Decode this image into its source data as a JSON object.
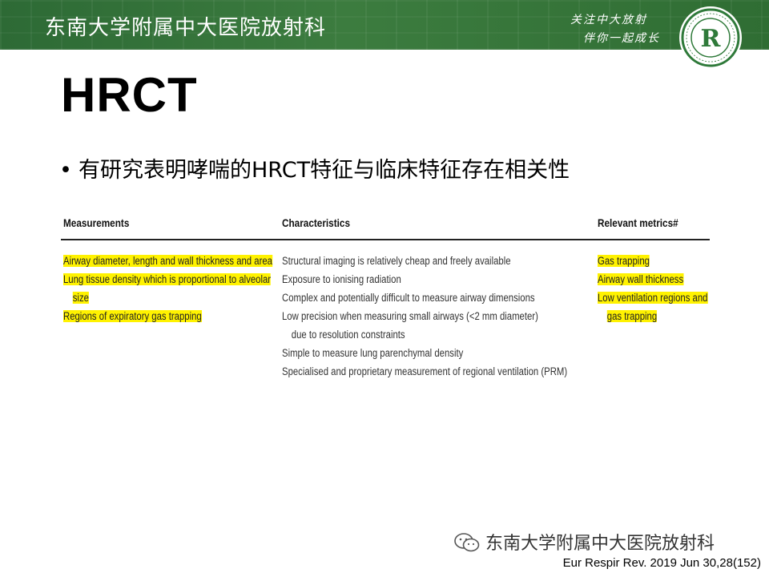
{
  "banner": {
    "title": "东南大学附属中大医院放射科",
    "slogan_line1": "关注中大放射",
    "slogan_line2": "伴你一起成长",
    "logo_letter": "R"
  },
  "slide": {
    "heading": "HRCT",
    "bullet": "有研究表明哮喘的HRCT特征与临床特征存在相关性"
  },
  "table": {
    "headers": {
      "measurements": "Measurements",
      "characteristics": "Characteristics",
      "relevant_metrics": "Relevant metrics#"
    },
    "measurements": [
      "Airway diameter, length and wall thickness and area",
      "Lung tissue density which is proportional to alveolar",
      "size",
      "Regions of expiratory gas trapping"
    ],
    "characteristics": [
      "Structural imaging is relatively cheap and freely available",
      "Exposure to ionising radiation",
      "Complex and potentially difficult to measure airway dimensions",
      "Low precision when measuring small airways (<2 mm diameter)",
      "due to resolution constraints",
      "Simple to measure lung parenchymal density",
      "Specialised and proprietary measurement of regional ventilation (PRM)"
    ],
    "relevant_metrics": [
      "Gas trapping",
      "Airway wall thickness",
      "Low ventilation regions and",
      "gas trapping"
    ]
  },
  "footer": {
    "brand": "东南大学附属中大医院放射科",
    "citation": "Eur Respir Rev. 2019 Jun 30,28(152)"
  },
  "colors": {
    "banner_green": "#3c7c3f",
    "highlight": "#fff200"
  },
  "icons": {
    "wechat": "wechat-icon",
    "logo": "hospital-logo"
  }
}
